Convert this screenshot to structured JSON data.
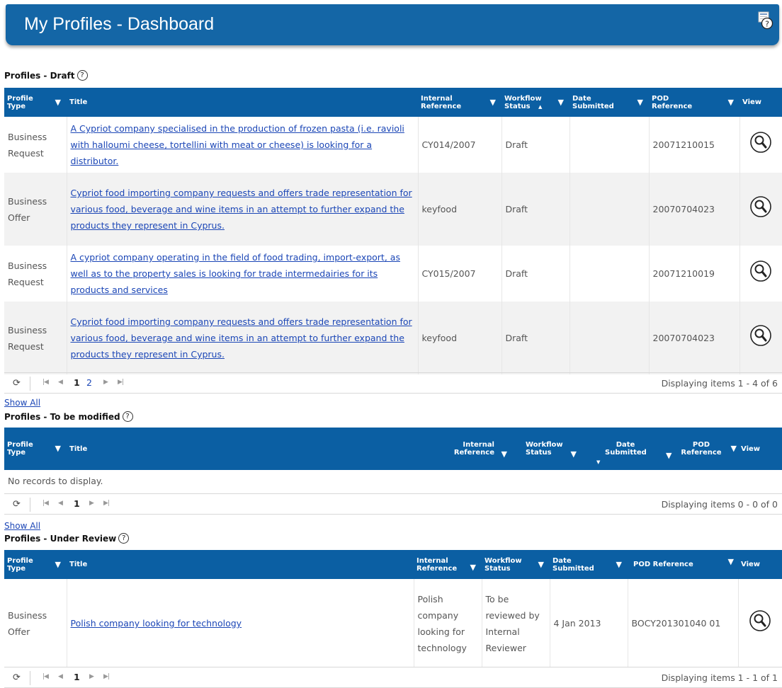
{
  "header": {
    "title": "My Profiles - Dashboard",
    "help_icon": "help-icon"
  },
  "draft": {
    "title": "Profiles - Draft",
    "columns": {
      "profile_type": "Profile Type",
      "title": "Title",
      "internal_reference": "Internal Reference",
      "workflow_status": "Workflow Status",
      "date_submitted": "Date Submitted",
      "pod_reference": "POD Reference",
      "view": "View"
    },
    "rows": [
      {
        "type_line1": "Business",
        "type_line2": "Request",
        "title": "A Cypriot company specialised in the production of frozen pasta (i.e. ravioli with halloumi cheese, tortellini with meat or cheese) is looking for a distributor.",
        "internal_reference": "CY014/2007",
        "workflow_status": "Draft",
        "date_submitted": "",
        "pod_reference": "20071210015"
      },
      {
        "type_line1": "Business",
        "type_line2": "Offer",
        "title": "Cypriot food importing company requests and offers trade representation for various food, beverage and wine items in an attempt to further expand the products they represent in Cyprus.",
        "internal_reference": "keyfood",
        "workflow_status": "Draft",
        "date_submitted": "",
        "pod_reference": "20070704023"
      },
      {
        "type_line1": "Business",
        "type_line2": "Request",
        "title": "A cypriot company operating in the field of food trading, import-export, as well as to the property sales is looking for trade intermedairies for its products and services",
        "internal_reference": "CY015/2007",
        "workflow_status": "Draft",
        "date_submitted": "",
        "pod_reference": "20071210019"
      },
      {
        "type_line1": "Business",
        "type_line2": "Request",
        "title": "Cypriot food importing company requests and offers trade representation for various food, beverage and wine items in an attempt to further expand the products they represent in Cyprus.",
        "internal_reference": "keyfood",
        "workflow_status": "Draft",
        "date_submitted": "",
        "pod_reference": "20070704023"
      }
    ],
    "pager": {
      "pages": [
        "1",
        "2"
      ],
      "current_page": "1",
      "info": "Displaying items 1 - 4 of 6"
    },
    "show_all": "Show All"
  },
  "to_be_modified": {
    "title": "Profiles - To be modified",
    "columns": {
      "profile_type": "Profile Type",
      "title": "Title",
      "internal_reference": "Internal Reference",
      "workflow_status": "Workflow Status",
      "date_submitted": "Date Submitted",
      "pod_reference": "POD Reference",
      "view": "View"
    },
    "empty_message": "No records to display.",
    "pager": {
      "pages": [
        "1"
      ],
      "current_page": "1",
      "info": "Displaying items 0 - 0 of 0"
    },
    "show_all": "Show All"
  },
  "under_review": {
    "title": "Profiles - Under Review",
    "columns": {
      "profile_type": "Profile Type",
      "title": "Title",
      "internal_reference": "Internal Reference",
      "workflow_status": "Workflow Status",
      "date_submitted": "Date Submitted",
      "pod_reference": "POD Reference",
      "view": "View"
    },
    "rows": [
      {
        "type_line1": "Business",
        "type_line2": "Offer",
        "title": "Polish company looking for technology",
        "internal_reference": "Polish company looking for technology",
        "workflow_status": "To be reviewed by Internal Reviewer",
        "date_submitted": "4 Jan 2013",
        "pod_reference": "BOCY201301040 01"
      }
    ],
    "pager": {
      "pages": [
        "1"
      ],
      "current_page": "1",
      "info": "Displaying items 1 - 1 of 1"
    }
  },
  "icons": {
    "filter": "filter-icon",
    "sort_asc": "sort-ascending-icon",
    "sort_desc": "sort-descending-icon",
    "view": "magnifier-icon",
    "refresh": "refresh-icon",
    "first": "first-page-icon",
    "prev": "previous-page-icon",
    "next": "next-page-icon",
    "last": "last-page-icon"
  },
  "colors": {
    "header_bg": "#1466a6",
    "grid_header_bg": "#0b5fa3",
    "link": "#1b46b6"
  }
}
